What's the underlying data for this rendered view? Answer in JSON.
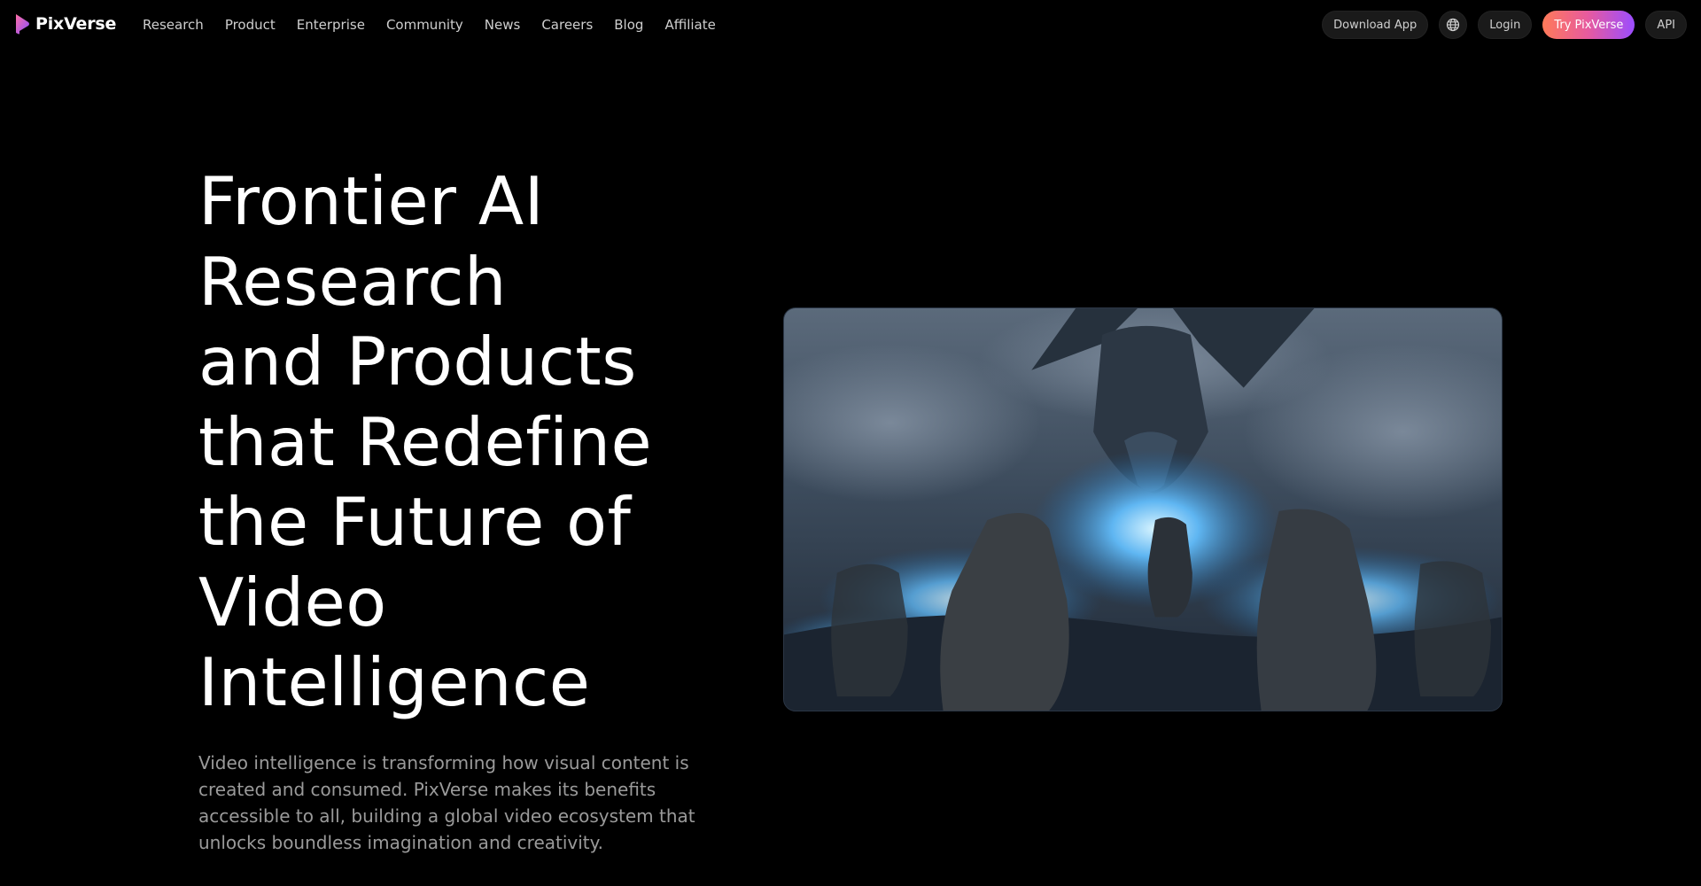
{
  "brand": {
    "name": "PixVerse"
  },
  "nav": {
    "menu": [
      {
        "label": "Research"
      },
      {
        "label": "Product"
      },
      {
        "label": "Enterprise"
      },
      {
        "label": "Community"
      },
      {
        "label": "News"
      },
      {
        "label": "Careers"
      },
      {
        "label": "Blog"
      },
      {
        "label": "Affiliate"
      }
    ],
    "download_label": "Download App",
    "language_icon": "globe-icon",
    "login_label": "Login",
    "try_label": "Try PixVerse",
    "api_label": "API"
  },
  "hero": {
    "title_lines": [
      "Frontier AI",
      "Research",
      "and Products",
      "that Redefine",
      "the Future of",
      "Video",
      "Intelligence"
    ],
    "description_lines": [
      "Video intelligence is transforming how visual content is",
      "created and consumed. PixVerse makes its benefits",
      "accessible to all, building a global video ecosystem that",
      "unlocks boundless imagination and creativity."
    ]
  },
  "colors": {
    "background": "#000000",
    "cta_gradient_start": "#ff7a59",
    "cta_gradient_end": "#9b4dff",
    "muted_text": "#9a9a9a"
  }
}
